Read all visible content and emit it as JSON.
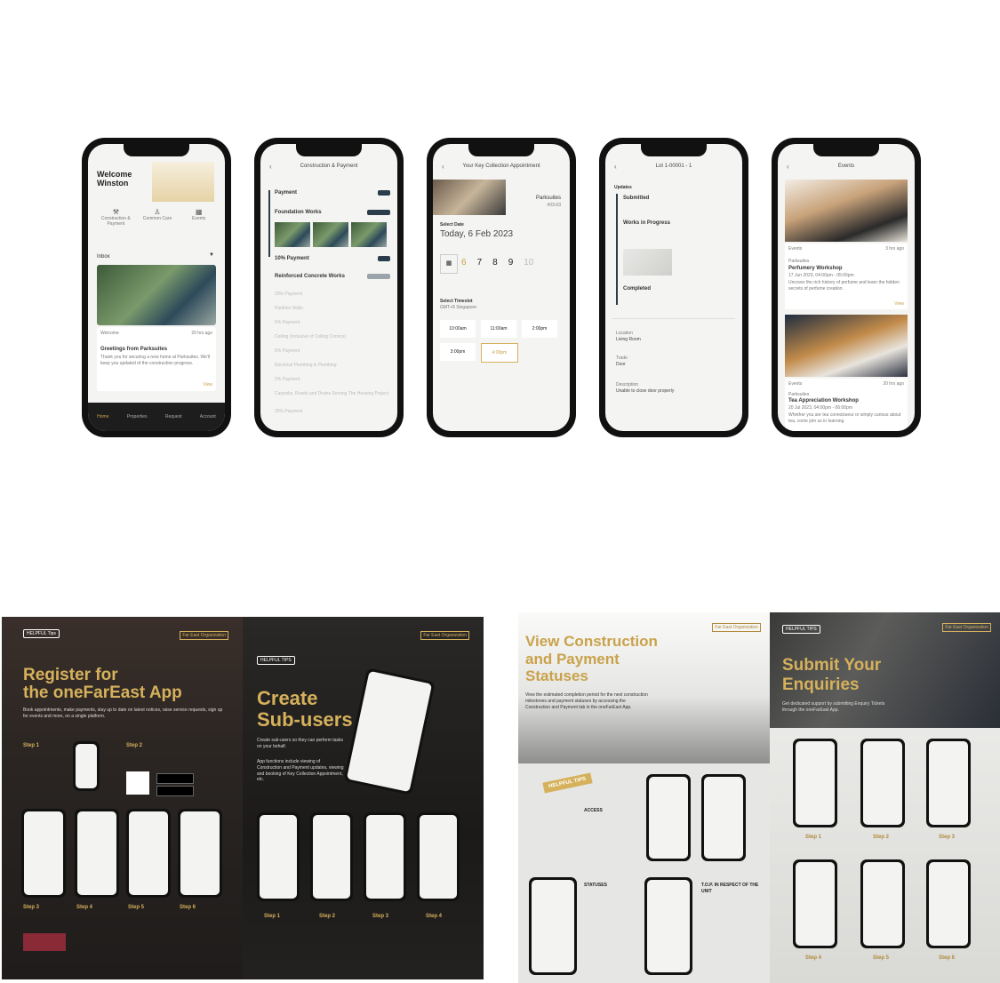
{
  "phone1": {
    "greeting": "Welcome Winston",
    "shortcuts": [
      "Construction & Payment",
      "Common Care",
      "Events"
    ],
    "inbox_label": "Inbox",
    "card_tag": "Welcome",
    "card_time": "20 hrs ago",
    "card_title": "Greetings from Parksuites",
    "card_body": "Thank you for securing a new home at Parksuites. We'll keep you updated of the construction progress.",
    "card_link": "View",
    "nav": [
      "Home",
      "Properties",
      "Request",
      "Account"
    ]
  },
  "phone2": {
    "header": "Construction & Payment",
    "item1": "Payment",
    "item2": "Foundation Works",
    "item3": "10% Payment",
    "item4": "Reinforced Concrete Works",
    "faded": [
      "20% Payment",
      "Partition Walls",
      "5% Payment",
      "Ceiling (Inclusive of Ceiling Cornice)",
      "5% Payment",
      "Electrical Plumbing & Plumbing",
      "5% Payment",
      "Carparks, Roads and Drains Serving The Housing Project",
      "25% Payment"
    ]
  },
  "phone3": {
    "header": "Your Key Collection Appointment",
    "project": "Parksuites",
    "unit": "#03-03",
    "select_date": "Select Date",
    "date": "Today, 6 Feb 2023",
    "days": [
      "6",
      "7",
      "8",
      "9",
      "10"
    ],
    "select_timeslot": "Select Timeslot",
    "timezone": "GMT+8 Singapore",
    "slots": [
      "10:00am",
      "11:00am",
      "2:00pm",
      "3:00pm",
      "4:00pm"
    ]
  },
  "phone4": {
    "header": "Lot 1-00001 - 1",
    "updates": "Updates",
    "status1": "Submitted",
    "status2": "Works in Progress",
    "status3": "Completed",
    "field1": "Location",
    "field1_val": "Living Room",
    "field2": "Trade",
    "field2_val": "Door",
    "field3": "Description",
    "field3_val": "Unable to close door properly"
  },
  "phone5": {
    "header": "Events",
    "event1_tag": "Events",
    "event1_time": "3 hrs ago",
    "event1_venue": "Parksuites",
    "event1_title": "Perfumery Workshop",
    "event1_date": "17 Jun 2023, 04:00pm - 05:00pm",
    "event1_body": "Uncover the rich history of perfume and learn the hidden secrets of perfume creation.",
    "event1_link": "View",
    "event2_tag": "Events",
    "event2_time": "20 hrs ago",
    "event2_venue": "Parksuites",
    "event2_title": "Tea Appreciation Workshop",
    "event2_date": "20 Jul 2023, 04:00pm - 06:00pm",
    "event2_body": "Whether you are tea connoisseur or simply curious about tea, come join us in learning"
  },
  "poster1": {
    "badge": "HELPFUL Tips",
    "logo": "Far East Organization",
    "title_line1": "Register for",
    "title_line2": "the oneFarEast App",
    "intro": "Book appointments, make payments, stay up to date on latest notices, raise service requests, sign up for events and more, on a single platform.",
    "steps": [
      "Step 1",
      "Step 2",
      "Step 3",
      "Step 4",
      "Step 5",
      "Step 6"
    ]
  },
  "poster2": {
    "badge": "HELPFUL TIPS",
    "logo": "Far East Organization",
    "title_line1": "Create",
    "title_line2": "Sub-users",
    "intro": "Create sub-users so they can perform tasks on your behalf.",
    "body": "App functions include viewing of Construction and Payment updates, viewing and booking of Key Collection Appointment, etc.",
    "steps": [
      "Step 1",
      "Step 2",
      "Step 3",
      "Step 4"
    ]
  },
  "poster3": {
    "logo": "Far East Organization",
    "title_line1": "View Construction",
    "title_line2": "and Payment",
    "title_line3": "Statuses",
    "intro": "View the estimated completion period for the next construction milestones and payment statuses by accessing the Construction and Payment tab in the oneFarEast App.",
    "badge": "HELPFUL TIPS",
    "sec1": "ACCESS",
    "sec2": "STATUSES",
    "sec3": "T.O.P. IN RESPECT OF THE UNIT"
  },
  "poster4": {
    "badge": "HELPFUL TIPS",
    "logo": "Far East Organization",
    "title_line1": "Submit Your",
    "title_line2": "Enquiries",
    "intro": "Get dedicated support by submitting Enquiry Tickets through the oneFarEast App.",
    "steps": [
      "Step 1",
      "Step 2",
      "Step 3",
      "Step 4",
      "Step 5",
      "Step 6"
    ]
  }
}
